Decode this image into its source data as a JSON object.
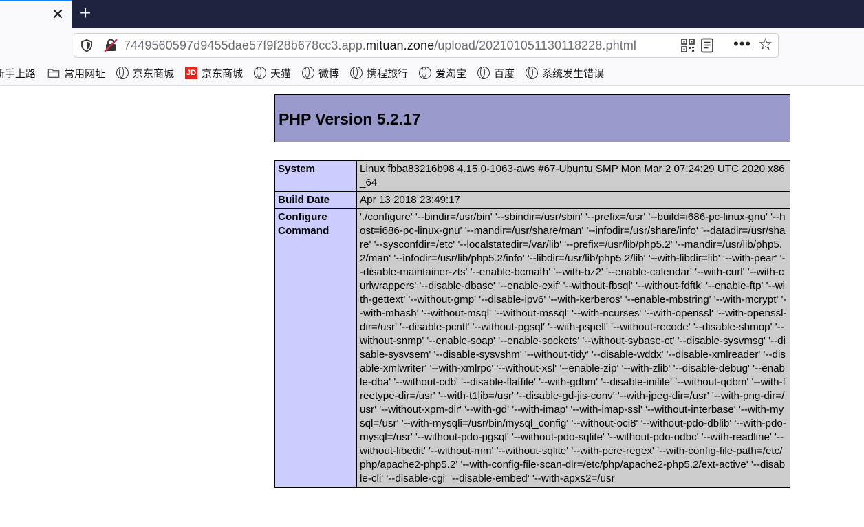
{
  "browser": {
    "url_prefix": "7449560597d9455dae57f9f28b678cc3.app.",
    "url_domain": "mituan.zone",
    "url_path": "/upload/20210105113011822​8.phtml",
    "more_label": "•••"
  },
  "bookmarks": [
    {
      "label": "新手上路",
      "icon": "none"
    },
    {
      "label": "常用网址",
      "icon": "folder-icon"
    },
    {
      "label": "京东商城",
      "icon": "globe-icon"
    },
    {
      "label": "京东商城",
      "icon": "jd-logo-icon"
    },
    {
      "label": "天猫",
      "icon": "globe-icon"
    },
    {
      "label": "微博",
      "icon": "globe-icon"
    },
    {
      "label": "携程旅行",
      "icon": "globe-icon"
    },
    {
      "label": "爱淘宝",
      "icon": "globe-icon"
    },
    {
      "label": "百度",
      "icon": "globe-icon"
    },
    {
      "label": "系统发生错误",
      "icon": "globe-icon"
    }
  ],
  "page": {
    "title": "PHP Version 5.2.17",
    "rows": [
      {
        "key": "System",
        "value": "Linux fbba83216b98 4.15.0-1063-aws #67-Ubuntu SMP Mon Mar 2 07:24:29 UTC 2020 x86_64"
      },
      {
        "key": "Build Date",
        "value": "Apr 13 2018 23:49:17"
      },
      {
        "key": "Configure Command",
        "value": "'./configure' '--bindir=/usr/bin' '--sbindir=/usr/sbin' '--prefix=/usr' '--build=i686-pc-linux-gnu' '--host=i686-pc-linux-gnu' '--mandir=/usr/share/man' '--infodir=/usr/share/info' '--datadir=/usr/share' '--sysconfdir=/etc' '--localstatedir=/var/lib' '--prefix=/usr/lib/php5.2' '--mandir=/usr/lib/php5.2/man' '--infodir=/usr/lib/php5.2/info' '--libdir=/usr/lib/php5.2/lib' '--with-libdir=lib' '--with-pear' '--disable-maintainer-zts' '--enable-bcmath' '--with-bz2' '--enable-calendar' '--with-curl' '--with-curlwrappers' '--disable-dbase' '--enable-exif' '--without-fbsql' '--without-fdftk' '--enable-ftp' '--with-gettext' '--without-gmp' '--disable-ipv6' '--with-kerberos' '--enable-mbstring' '--with-mcrypt' '--with-mhash' '--without-msql' '--without-mssql' '--with-ncurses' '--with-openssl' '--with-openssl-dir=/usr' '--disable-pcntl' '--without-pgsql' '--with-pspell' '--without-recode' '--disable-shmop' '--without-snmp' '--enable-soap' '--enable-sockets' '--without-sybase-ct' '--disable-sysvmsg' '--disable-sysvsem' '--disable-sysvshm' '--without-tidy' '--disable-wddx' '--disable-xmlreader' '--disable-xmlwriter' '--with-xmlrpc' '--without-xsl' '--enable-zip' '--with-zlib' '--disable-debug' '--enable-dba' '--without-cdb' '--disable-flatfile' '--with-gdbm' '--disable-inifile' '--without-qdbm' '--with-freetype-dir=/usr' '--with-t1lib=/usr' '--disable-gd-jis-conv' '--with-jpeg-dir=/usr' '--with-png-dir=/usr' '--without-xpm-dir' '--with-gd' '--with-imap' '--with-imap-ssl' '--without-interbase' '--with-mysql=/usr' '--with-mysqli=/usr/bin/mysql_config' '--without-oci8' '--without-pdo-dblib' '--with-pdo-mysql=/usr' '--without-pdo-pgsql' '--without-pdo-sqlite' '--without-pdo-odbc' '--with-readline' '--without-libedit' '--without-mm' '--without-sqlite' '--with-pcre-regex' '--with-config-file-path=/etc/php/apache2-php5.2' '--with-config-file-scan-dir=/etc/php/apache2-php5.2/ext-active' '--disable-cli' '--disable-cgi' '--disable-embed' '--with-apxs2=/usr"
      }
    ]
  }
}
